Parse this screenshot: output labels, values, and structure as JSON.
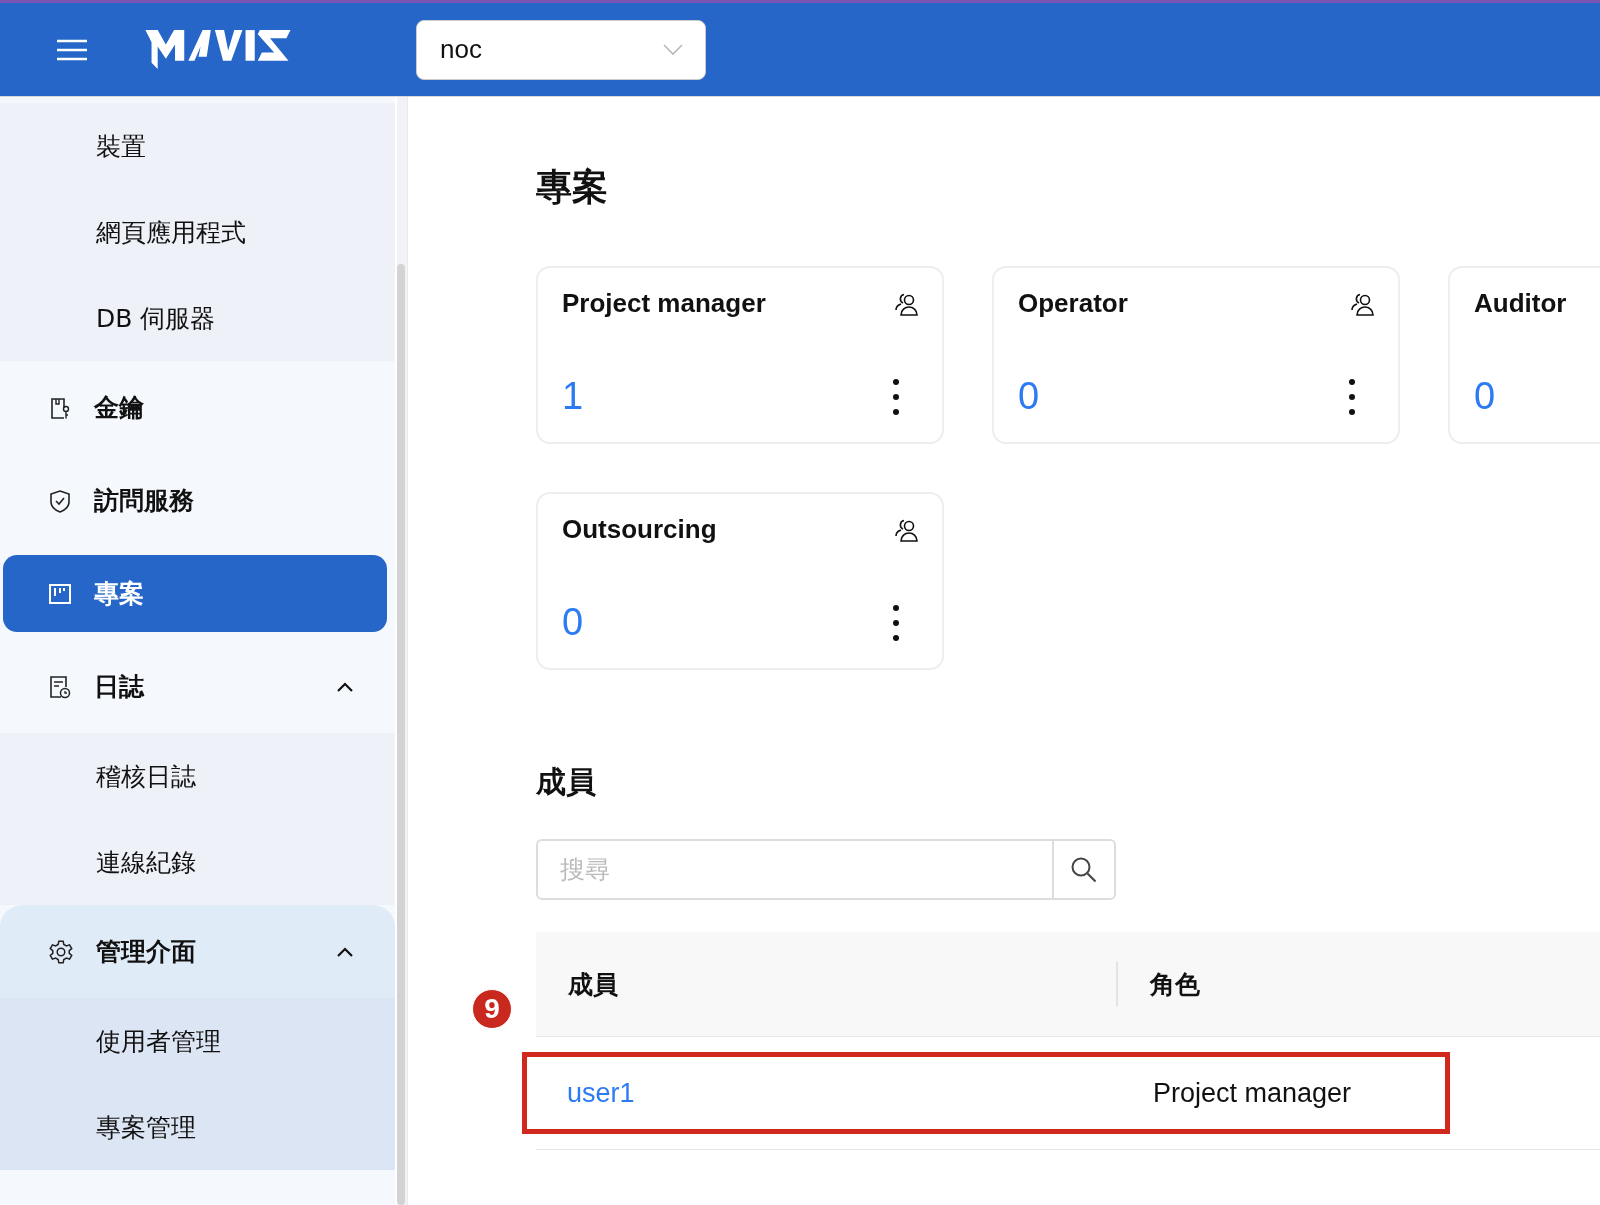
{
  "header": {
    "project_select": {
      "value": "noc"
    }
  },
  "sidebar": {
    "cut_children": [
      {
        "label": "裝置"
      },
      {
        "label": "網頁應用程式"
      },
      {
        "label": "DB 伺服器"
      }
    ],
    "items": [
      {
        "label": "金鑰",
        "selected": false,
        "highlighted": false
      },
      {
        "label": "訪問服務",
        "selected": false,
        "highlighted": false
      },
      {
        "label": "專案",
        "selected": true,
        "highlighted": false
      },
      {
        "label": "日誌",
        "selected": false,
        "highlighted": false,
        "expanded": true,
        "children": [
          {
            "label": "稽核日誌"
          },
          {
            "label": "連線紀錄"
          }
        ]
      },
      {
        "label": "管理介面",
        "selected": false,
        "highlighted": true,
        "expanded": true,
        "children": [
          {
            "label": "使用者管理"
          },
          {
            "label": "專案管理"
          }
        ]
      }
    ]
  },
  "page_title": "專案",
  "role_cards": [
    {
      "title": "Project manager",
      "count": "1"
    },
    {
      "title": "Operator",
      "count": "0"
    },
    {
      "title": "Auditor",
      "count": "0"
    },
    {
      "title": "Outsourcing",
      "count": "0"
    }
  ],
  "members": {
    "title": "成員",
    "search": {
      "placeholder": "搜尋"
    },
    "columns": [
      "成員",
      "角色"
    ],
    "rows": [
      {
        "member": "user1",
        "role": "Project manager",
        "highlighted": true
      }
    ]
  },
  "annotation": {
    "step": "9"
  }
}
